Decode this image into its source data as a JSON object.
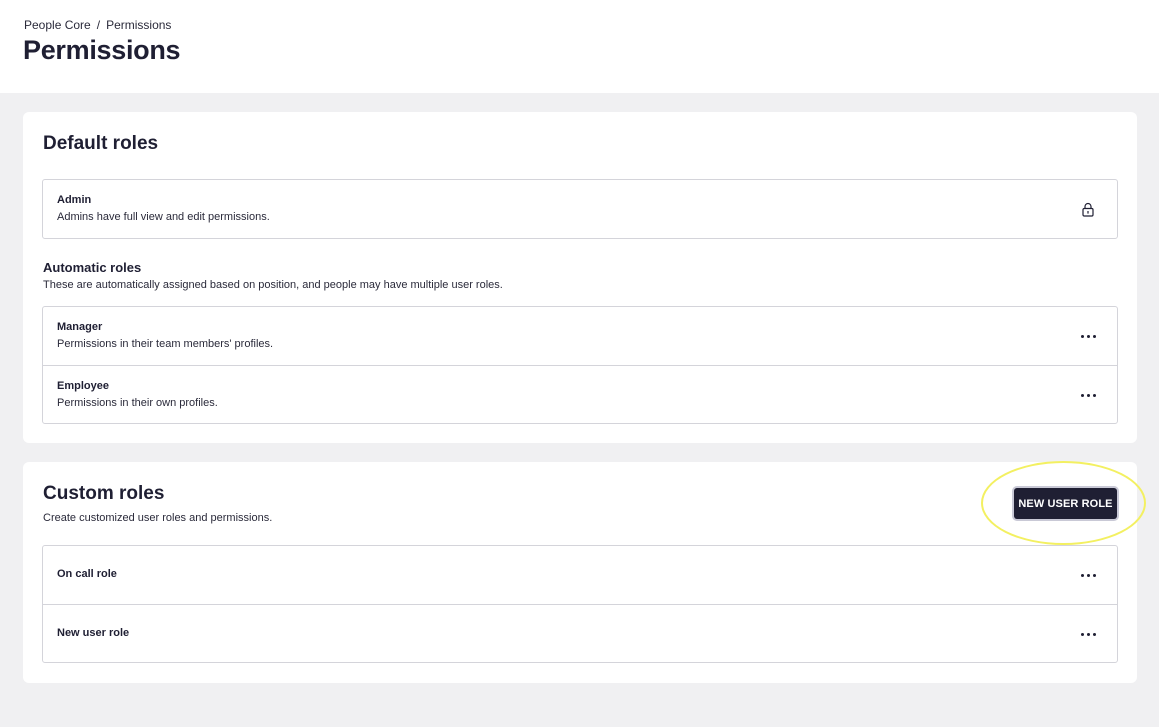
{
  "header": {
    "breadcrumb": {
      "parent": "People Core",
      "separator": "/",
      "current": "Permissions"
    },
    "title": "Permissions"
  },
  "default_roles": {
    "title": "Default roles",
    "admin": {
      "name": "Admin",
      "description": "Admins have full view and edit permissions.",
      "icon": "lock-icon"
    },
    "automatic": {
      "title": "Automatic roles",
      "description": "These are automatically assigned based on position, and people may have multiple user roles.",
      "items": [
        {
          "name": "Manager",
          "description": "Permissions in their team members' profiles.",
          "icon": "more-options-icon"
        },
        {
          "name": "Employee",
          "description": "Permissions in their own profiles.",
          "icon": "more-options-icon"
        }
      ]
    }
  },
  "custom_roles": {
    "title": "Custom roles",
    "description": "Create customized user roles and permissions.",
    "new_button_label": "NEW USER ROLE",
    "items": [
      {
        "name": "On call role",
        "icon": "more-options-icon"
      },
      {
        "name": "New user role",
        "icon": "more-options-icon"
      }
    ]
  },
  "colors": {
    "primary_dark": "#1f1f33",
    "page_background": "#f0f0f2",
    "highlight": "#f3f061"
  }
}
